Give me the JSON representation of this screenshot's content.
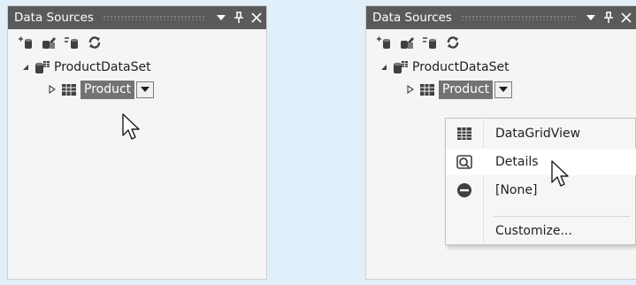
{
  "left_panel": {
    "title": "Data Sources",
    "toolbar_icons": [
      "add-data-source-icon",
      "edit-dataset-designer-icon",
      "configure-dataset-icon",
      "refresh-icon"
    ],
    "tree": {
      "root_label": "ProductDataSet",
      "child_label": "Product"
    }
  },
  "right_panel": {
    "title": "Data Sources",
    "toolbar_icons": [
      "add-data-source-icon",
      "edit-dataset-designer-icon",
      "configure-dataset-icon",
      "refresh-icon"
    ],
    "tree": {
      "root_label": "ProductDataSet",
      "child_label": "Product"
    },
    "menu": {
      "items": [
        {
          "label": "DataGridView",
          "icon": "datagridview-icon"
        },
        {
          "label": "Details",
          "icon": "details-icon",
          "hovered": true
        },
        {
          "label": "[None]",
          "icon": "none-icon"
        },
        {
          "label": "Customize...",
          "icon": ""
        }
      ]
    }
  },
  "colors": {
    "background": "#e1effa",
    "titlebar": "#5a5a5a",
    "panel": "#f5f5f5",
    "selection": "#737373"
  }
}
